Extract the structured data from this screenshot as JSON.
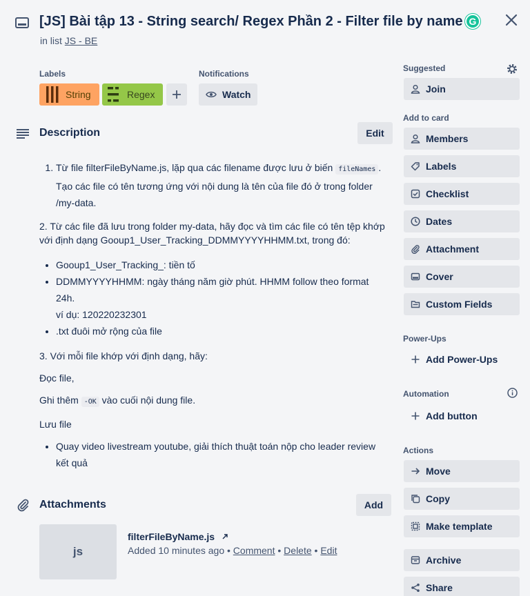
{
  "card": {
    "title": "[JS] Bài tập 13 - String search/ Regex Phần 2 - Filter file by name",
    "in_list_prefix": "in list",
    "list_name": "JS - BE",
    "grammarly_letter": "G"
  },
  "labels": {
    "heading": "Labels",
    "items": [
      {
        "name": "String",
        "color": "#fea362"
      },
      {
        "name": "Regex",
        "color": "#94c748"
      }
    ]
  },
  "notifications": {
    "heading": "Notifications",
    "watch_label": "Watch"
  },
  "description": {
    "heading": "Description",
    "edit_label": "Edit",
    "item1_pre": "Từ file filterFileByName.js, lặp qua các filename được lưu ở biến",
    "item1_code": "fileNames",
    "item1_post": ". Tạo các file có tên tương ứng với nội dung là tên của file đó ở trong folder /my-data.",
    "para2": "2. Từ các file đã lưu trong folder my-data, hãy đọc và tìm các file có tên tệp khớp với định dạng Gooup1_User_Tracking_DDMMYYYYHHMM.txt, trong đó:",
    "bullet1": "Gooup1_User_Tracking_: tiền tố",
    "bullet2_line1": "DDMMYYYYHHMM: ngày tháng năm giờ phút. HHMM follow theo format 24h.",
    "bullet2_line2": "ví dụ: 120220232301",
    "bullet3": ".txt đuôi mở rộng của file",
    "para3": "3. Với mỗi file khớp với định dạng, hãy:",
    "para4": "Đọc file,",
    "para5_pre": "Ghi thêm",
    "para5_code": "-OK",
    "para5_post": "vào cuối nội dung file.",
    "para6": "Lưu file",
    "bullet4": "Quay video livestream youtube, giải thích thuật toán nộp cho leader review kết quả"
  },
  "attachments": {
    "heading": "Attachments",
    "add_label": "Add",
    "file": {
      "thumb_text": "js",
      "name": "filterFileByName.js",
      "added": "Added 10 minutes ago",
      "sep": "•",
      "comment": "Comment",
      "delete": "Delete",
      "edit": "Edit"
    }
  },
  "sidebar": {
    "suggested": {
      "heading": "Suggested",
      "join": "Join"
    },
    "add_to_card": {
      "heading": "Add to card",
      "members": "Members",
      "labels": "Labels",
      "checklist": "Checklist",
      "dates": "Dates",
      "attachment": "Attachment",
      "cover": "Cover",
      "custom_fields": "Custom Fields"
    },
    "power_ups": {
      "heading": "Power-Ups",
      "add": "Add Power-Ups"
    },
    "automation": {
      "heading": "Automation",
      "add_button": "Add button"
    },
    "actions": {
      "heading": "Actions",
      "move": "Move",
      "copy": "Copy",
      "make_template": "Make template",
      "archive": "Archive",
      "share": "Share"
    }
  }
}
